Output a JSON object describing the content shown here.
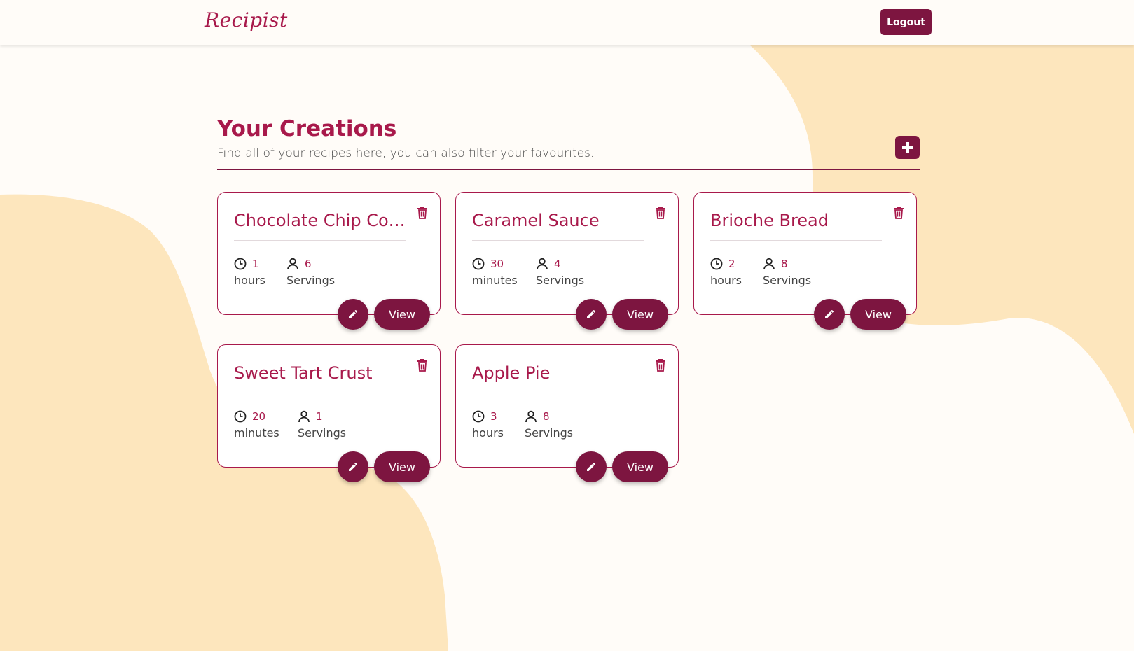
{
  "app": {
    "logo": "Recipist"
  },
  "nav": {
    "logout_label": "Logout"
  },
  "header": {
    "title": "Your Creations",
    "subtitle": "Find all of your recipes here, you can also filter your favourites."
  },
  "add_icon": "plus-icon",
  "colors": {
    "accent": "#a8194b",
    "button": "#7d1540",
    "background": "#fffcf8",
    "blob": "#fde6bd"
  },
  "recipes": [
    {
      "title": "Chocolate Chip Coo...",
      "time_value": "1",
      "time_unit": "hours",
      "servings_value": "6",
      "servings_label": "Servings",
      "view_label": "View"
    },
    {
      "title": "Caramel Sauce",
      "time_value": "30",
      "time_unit": "minutes",
      "servings_value": "4",
      "servings_label": "Servings",
      "view_label": "View"
    },
    {
      "title": "Brioche Bread",
      "time_value": "2",
      "time_unit": "hours",
      "servings_value": "8",
      "servings_label": "Servings",
      "view_label": "View"
    },
    {
      "title": "Sweet Tart Crust",
      "time_value": "20",
      "time_unit": "minutes",
      "servings_value": "1",
      "servings_label": "Servings",
      "view_label": "View"
    },
    {
      "title": "Apple Pie",
      "time_value": "3",
      "time_unit": "hours",
      "servings_value": "8",
      "servings_label": "Servings",
      "view_label": "View"
    }
  ]
}
